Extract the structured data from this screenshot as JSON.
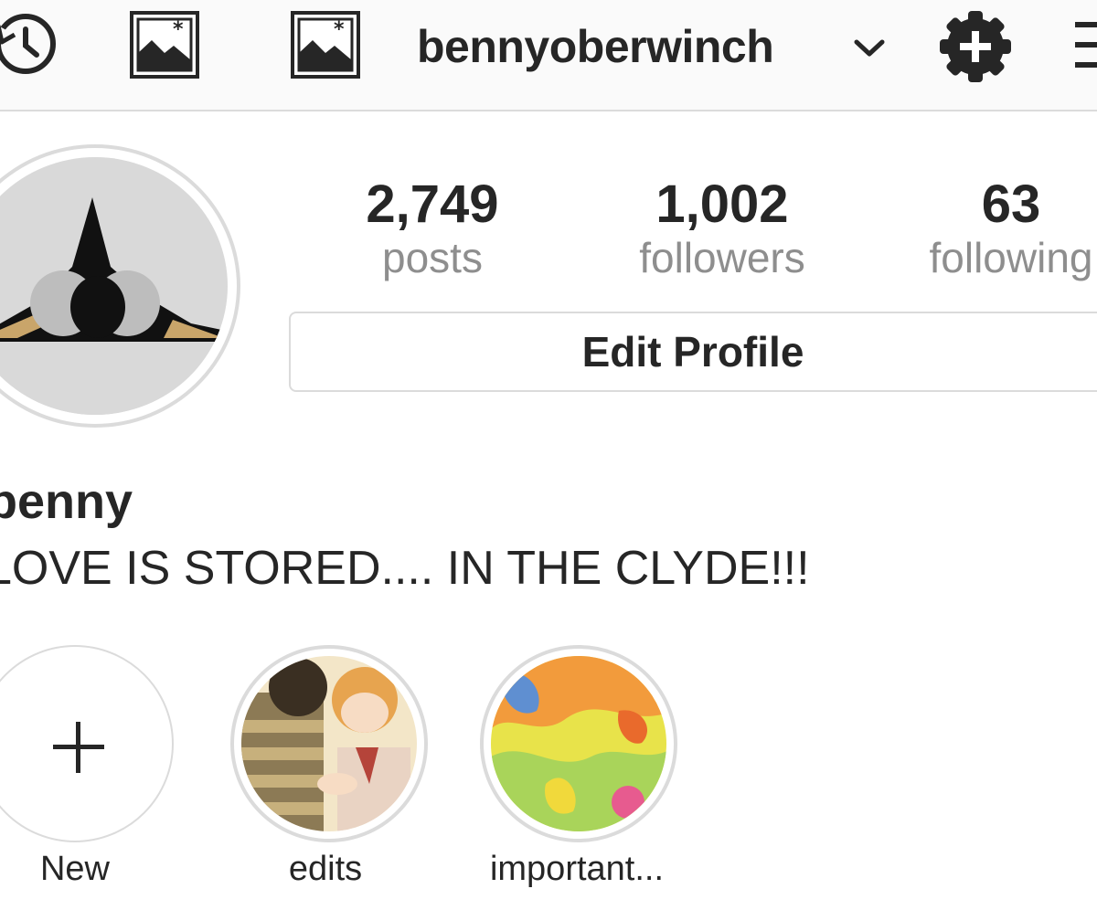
{
  "header": {
    "username": "bennyoberwinch",
    "icons": [
      "history-icon",
      "photo-icon",
      "photo-icon",
      "chevron-down-icon",
      "add-gear-icon",
      "menu-icon"
    ]
  },
  "profile": {
    "stats": [
      {
        "value": "2,749",
        "label": "posts"
      },
      {
        "value": "1,002",
        "label": "followers"
      },
      {
        "value": "63",
        "label": "following"
      }
    ],
    "edit_button": "Edit Profile",
    "display_name": "benny",
    "bio": "LOVE IS STORED.... IN THE CLYDE!!!"
  },
  "highlights": [
    {
      "label": "New"
    },
    {
      "label": "edits"
    },
    {
      "label": "important..."
    }
  ],
  "colors": {
    "text": "#262626",
    "muted": "#8e8e8e",
    "border": "#dbdbdb",
    "bar": "#fafafa"
  }
}
